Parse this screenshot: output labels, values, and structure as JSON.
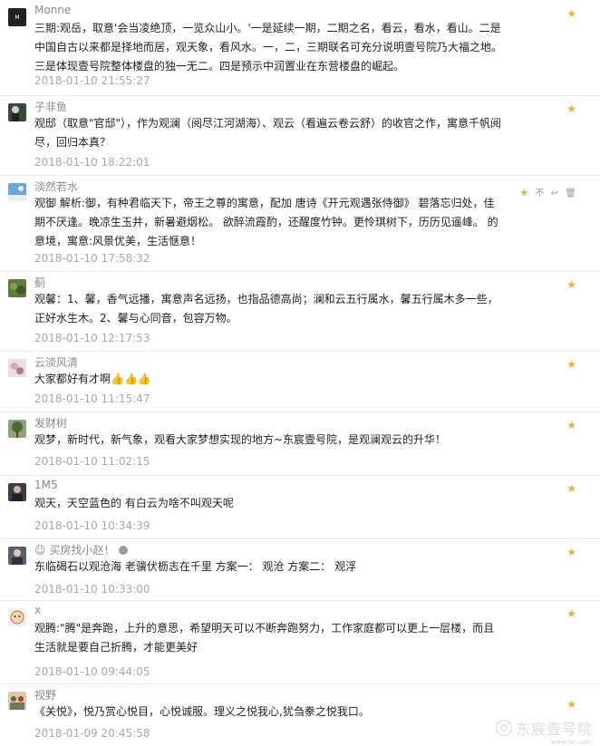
{
  "comments": [
    {
      "name": "Monne",
      "text": "三期:观岳，取意'会当凌绝顶，一览众山小。'一是延续一期，二期之名，看云，看水，看山。二是中国自古以来都是择地而居，观天象，看风水。一，二，三期联名可充分说明壹号院乃大福之地。三是体现壹号院整体楼盘的独一无二。四是预示中润置业在东营楼盘的崛起。",
      "time": "2018-01-10 21:55:27"
    },
    {
      "name": "子非鱼",
      "text": "观邸（取意\"官邸\"），作为观澜（阅尽江河湖海）、观云（看遍云卷云舒）的收官之作，寓意千帆阅尽，回归本真？",
      "time": "2018-01-10 18:22:01"
    },
    {
      "name": "淡然若水",
      "text": "观御 解析:御，有种君临天下，帝王之尊的寓意，配加 唐诗《开元观遇张侍御》 碧落忘归处，佳期不厌逢。晚凉生玉井，新暑避烟松。 欲醉流霞酌，还醒度竹钟。更怜琪树下，历历见遥峰。 的意境，寓意:风景优美，生活惬意！",
      "time": "2018-01-10 17:58:32"
    },
    {
      "name": "蓟",
      "text": "观馨：1、馨，香气远播，寓意声名远扬，也指品德高尚；澜和云五行属水，馨五行属木多一些，正好水生木。2、馨与心同音，包容万物。",
      "time": "2018-01-10 12:17:53"
    },
    {
      "name": "云淡风清",
      "text": "大家都好有才啊👍👍👍",
      "time": "2018-01-10 11:15:47"
    },
    {
      "name": "发财树",
      "text": "观梦，新时代，新气象，观看大家梦想实现的地方~东宸壹号院，是观澜观云的升华！",
      "time": "2018-01-10 11:02:15"
    },
    {
      "name": "1M5",
      "text": "观天，天空蓝色的 有白云为啥不叫观天呢",
      "time": "2018-01-10 10:34:39"
    },
    {
      "name": "买房找小赵！",
      "text": "东临碣石以观沧海 老骥伏枥志在千里 方案一： 观沧 方案二： 观浮",
      "time": "2018-01-10 10:33:00"
    },
    {
      "name": "x",
      "text": "观腾:\"腾\"是奔跑，上升的意思，希望明天可以不断奔跑努力，工作家庭都可以更上一层楼，而且生活就是要自己折腾，才能更美好",
      "time": "2018-01-10 09:44:05"
    },
    {
      "name": "视野",
      "text": "《关悦》，悦乃赏心悦目，心悦诚服。理义之悦我心,犹刍豢之悦我口。",
      "time": "2018-01-09 20:45:58"
    }
  ],
  "icons": {
    "star": "★",
    "dislike": "不",
    "reply": "↩",
    "delete": "🗑",
    "name_badge": "☺"
  },
  "watermark": {
    "text": "东宸壹号院",
    "small": "www.lxj.com"
  },
  "colors": {
    "star": "#e3b23a",
    "name": "#8a8a8a",
    "time": "#a8a8a8"
  }
}
